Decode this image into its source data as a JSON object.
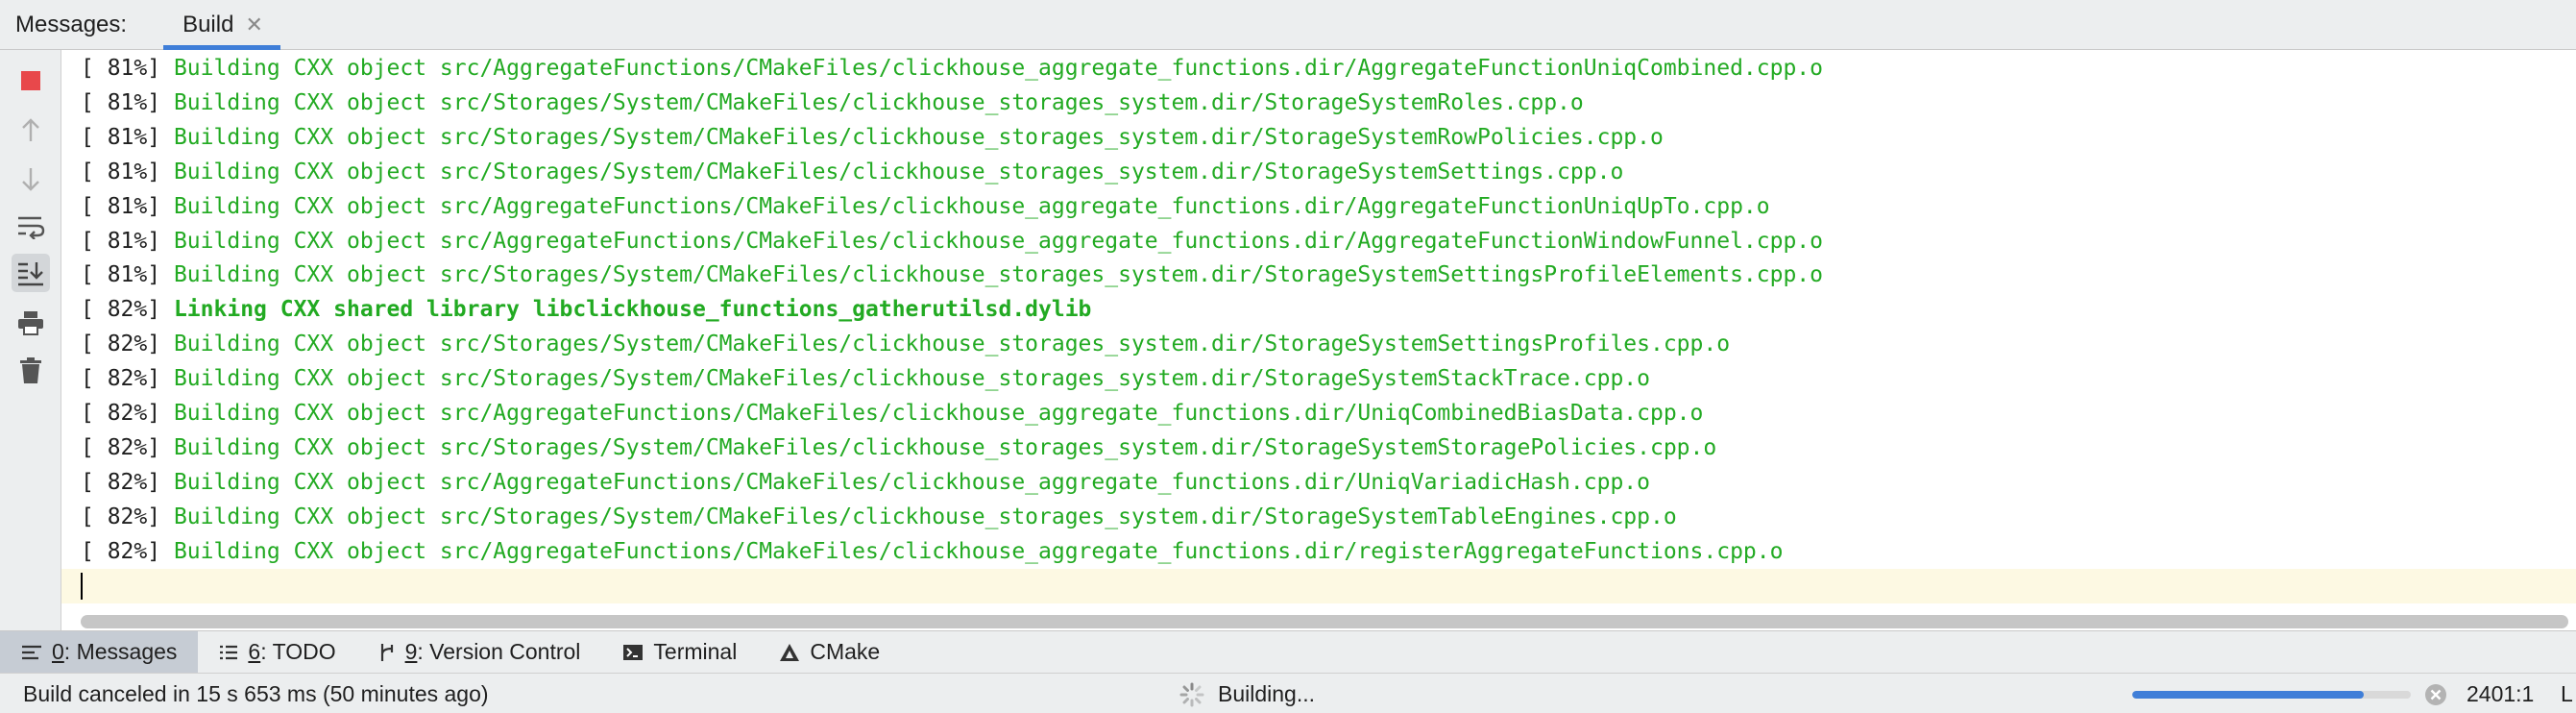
{
  "tabbar": {
    "label": "Messages:",
    "tab": "Build",
    "close_glyph": "✕"
  },
  "toolbar": {
    "icons": [
      "stop-icon",
      "arrow-up-icon",
      "arrow-down-icon",
      "soft-wrap-icon",
      "scroll-to-end-icon",
      "print-icon",
      "trash-icon"
    ],
    "accent_stop": "#e8484b"
  },
  "console": {
    "lines": [
      {
        "pct": "[ 81%]",
        "msg": "Building CXX object src/AggregateFunctions/CMakeFiles/clickhouse_aggregate_functions.dir/AggregateFunctionUniqCombined.cpp.o"
      },
      {
        "pct": "[ 81%]",
        "msg": "Building CXX object src/Storages/System/CMakeFiles/clickhouse_storages_system.dir/StorageSystemRoles.cpp.o"
      },
      {
        "pct": "[ 81%]",
        "msg": "Building CXX object src/Storages/System/CMakeFiles/clickhouse_storages_system.dir/StorageSystemRowPolicies.cpp.o"
      },
      {
        "pct": "[ 81%]",
        "msg": "Building CXX object src/Storages/System/CMakeFiles/clickhouse_storages_system.dir/StorageSystemSettings.cpp.o"
      },
      {
        "pct": "[ 81%]",
        "msg": "Building CXX object src/AggregateFunctions/CMakeFiles/clickhouse_aggregate_functions.dir/AggregateFunctionUniqUpTo.cpp.o"
      },
      {
        "pct": "[ 81%]",
        "msg": "Building CXX object src/AggregateFunctions/CMakeFiles/clickhouse_aggregate_functions.dir/AggregateFunctionWindowFunnel.cpp.o"
      },
      {
        "pct": "[ 81%]",
        "msg": "Building CXX object src/Storages/System/CMakeFiles/clickhouse_storages_system.dir/StorageSystemSettingsProfileElements.cpp.o"
      },
      {
        "pct": "[ 82%]",
        "msg": "Linking CXX shared library libclickhouse_functions_gatherutilsd.dylib",
        "bold": true
      },
      {
        "pct": "[ 82%]",
        "msg": "Building CXX object src/Storages/System/CMakeFiles/clickhouse_storages_system.dir/StorageSystemSettingsProfiles.cpp.o"
      },
      {
        "pct": "[ 82%]",
        "msg": "Building CXX object src/Storages/System/CMakeFiles/clickhouse_storages_system.dir/StorageSystemStackTrace.cpp.o"
      },
      {
        "pct": "[ 82%]",
        "msg": "Building CXX object src/AggregateFunctions/CMakeFiles/clickhouse_aggregate_functions.dir/UniqCombinedBiasData.cpp.o"
      },
      {
        "pct": "[ 82%]",
        "msg": "Building CXX object src/Storages/System/CMakeFiles/clickhouse_storages_system.dir/StorageSystemStoragePolicies.cpp.o"
      },
      {
        "pct": "[ 82%]",
        "msg": "Building CXX object src/AggregateFunctions/CMakeFiles/clickhouse_aggregate_functions.dir/UniqVariadicHash.cpp.o"
      },
      {
        "pct": "[ 82%]",
        "msg": "Building CXX object src/Storages/System/CMakeFiles/clickhouse_storages_system.dir/StorageSystemTableEngines.cpp.o"
      },
      {
        "pct": "[ 82%]",
        "msg": "Building CXX object src/AggregateFunctions/CMakeFiles/clickhouse_aggregate_functions.dir/registerAggregateFunctions.cpp.o"
      }
    ],
    "success_color": "#22aa22"
  },
  "toolwindows": [
    {
      "key": "0",
      "label": ": Messages",
      "icon": "messages-icon",
      "active": true
    },
    {
      "key": "6",
      "label": ": TODO",
      "icon": "list-icon",
      "active": false
    },
    {
      "key": "9",
      "label": ": Version Control",
      "icon": "vcs-branch-icon",
      "active": false
    },
    {
      "key": "",
      "label": "Terminal",
      "icon": "terminal-icon",
      "active": false
    },
    {
      "key": "",
      "label": "CMake",
      "icon": "cmake-triangle-icon",
      "active": false
    }
  ],
  "status": {
    "message": "Build canceled in 15 s 653 ms (50 minutes ago)",
    "task": "Building...",
    "progress": 0.83,
    "position": "2401:1",
    "encoding": "L"
  }
}
